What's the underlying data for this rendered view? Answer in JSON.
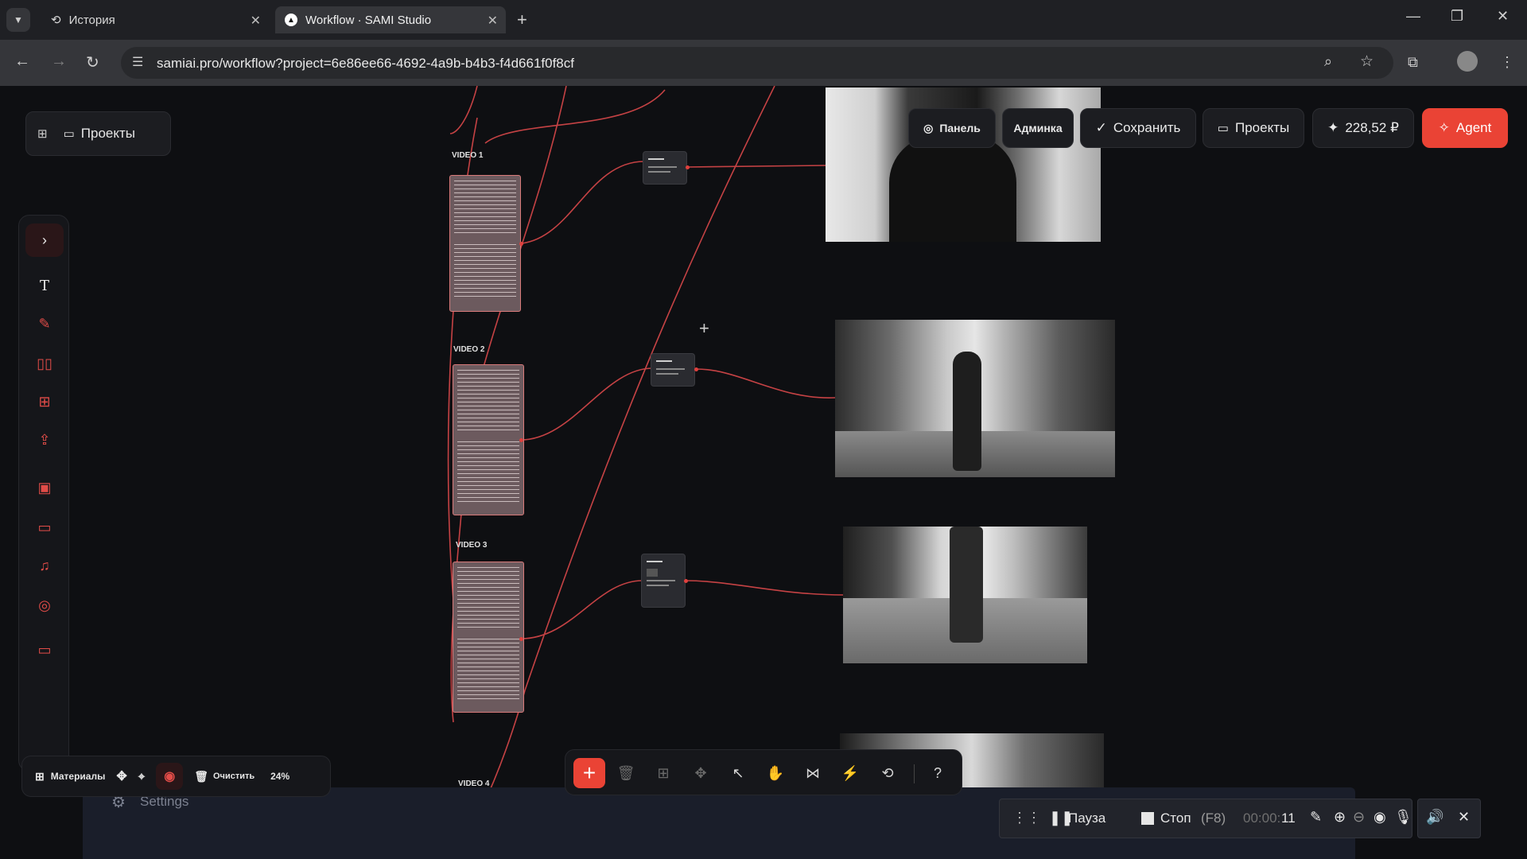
{
  "browser": {
    "tabs": [
      {
        "title": "История"
      },
      {
        "title": "Workflow · SAMI Studio"
      }
    ],
    "url": "samiai.pro/workflow?project=6e86ee66-4692-4a9b-b4b3-f4d661f0f8cf"
  },
  "app": {
    "projects_left": "Проекты",
    "topbar": {
      "panel": "Панель",
      "admin": "Админка",
      "save": "Сохранить",
      "projects": "Проекты",
      "balance": "228,52 ₽",
      "agent": "Agent"
    },
    "groups": [
      "VIDEO 1",
      "VIDEO 2",
      "VIDEO 3",
      "VIDEO 4"
    ],
    "bottom_left": {
      "materials": "Материалы",
      "clear": "Очистить",
      "zoom": "24%"
    },
    "settings_label": "Settings"
  },
  "recorder": {
    "pause": "Пауза",
    "stop": "Стоп",
    "stop_key": "(F8)",
    "time_dim": "00:00:",
    "time_bright": "11"
  },
  "colors": {
    "accent": "#ea4335",
    "wire": "#d9484a",
    "node_fill": "#6c5a5e"
  }
}
